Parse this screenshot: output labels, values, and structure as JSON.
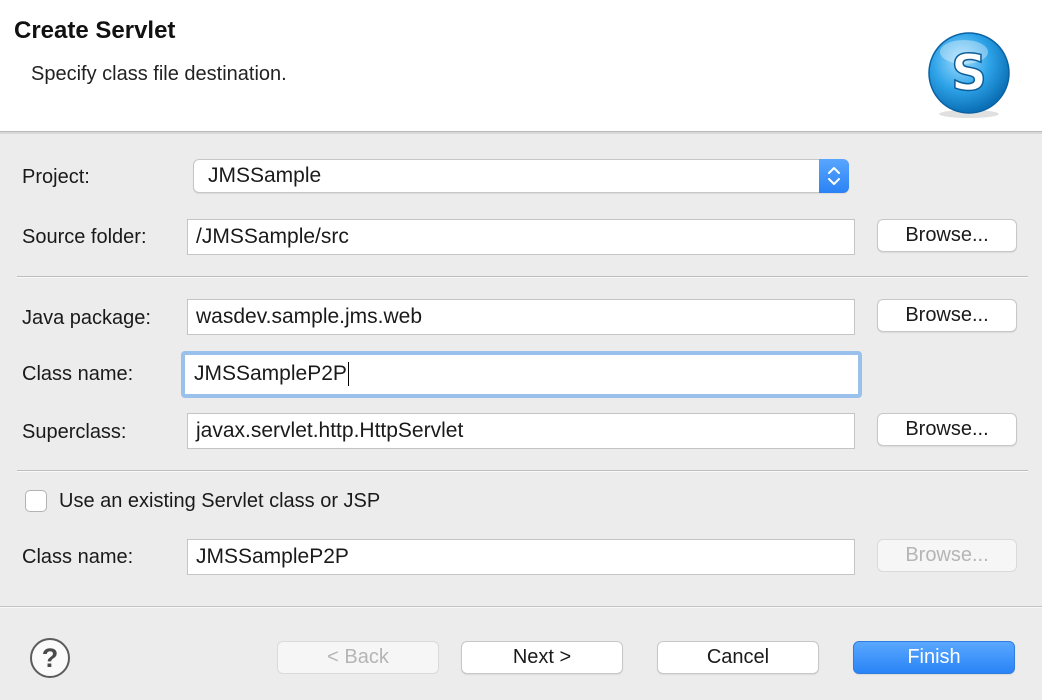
{
  "header": {
    "title": "Create Servlet",
    "description": "Specify class file destination.",
    "logo_letter": "S"
  },
  "form": {
    "project_label": "Project:",
    "project_value": "JMSSample",
    "source_folder_label": "Source folder:",
    "source_folder_value": "/JMSSample/src",
    "java_package_label": "Java package:",
    "java_package_value": "wasdev.sample.jms.web",
    "class_name_label": "Class name:",
    "class_name_value": "JMSSampleP2P",
    "superclass_label": "Superclass:",
    "superclass_value": "javax.servlet.http.HttpServlet",
    "browse_label": "Browse...",
    "existing_checkbox_label": "Use an existing Servlet class or JSP",
    "existing_checkbox_checked": false,
    "existing_class_name_label": "Class name:",
    "existing_class_name_value": "JMSSampleP2P"
  },
  "footer": {
    "help_symbol": "?",
    "back_label": "< Back",
    "next_label": "Next >",
    "cancel_label": "Cancel",
    "finish_label": "Finish"
  },
  "colors": {
    "accent": "#2a84f7",
    "focus_ring": "#9ac1ec"
  }
}
